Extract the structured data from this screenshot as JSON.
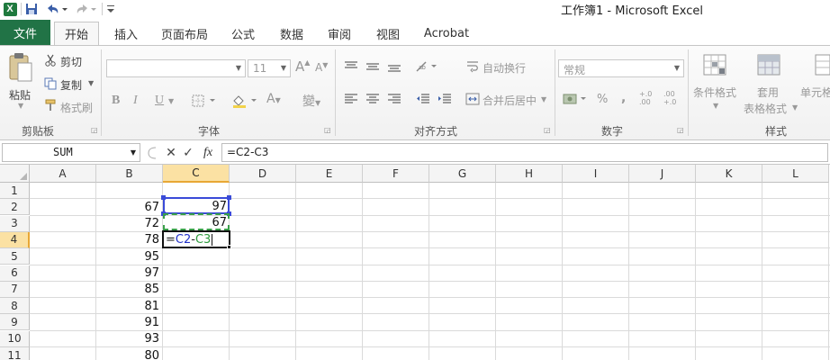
{
  "window": {
    "title": "工作簿1  -  Microsoft Excel"
  },
  "quick_access": {
    "app_icon_label": "X",
    "undo_icon": "undo-icon",
    "redo_icon": "redo-icon",
    "save_icon": "save-icon"
  },
  "tabs": [
    "文件",
    "开始",
    "插入",
    "页面布局",
    "公式",
    "数据",
    "审阅",
    "视图",
    "Acrobat"
  ],
  "ribbon": {
    "clipboard": {
      "paste": "粘贴",
      "cut": "剪切",
      "copy": "复制",
      "format_painter": "格式刷",
      "label": "剪贴板"
    },
    "font": {
      "font_size": "11",
      "bold": "B",
      "italic": "I",
      "underline": "U",
      "grow": "A",
      "shrink": "A",
      "font_color": "A",
      "phonetic": "變",
      "label": "字体"
    },
    "alignment": {
      "wrap_text": "自动换行",
      "merge_center": "合并后居中",
      "label": "对齐方式"
    },
    "number": {
      "format": "常规",
      "percent": "%",
      "comma": ",",
      "inc_decimal": "+.0 .00",
      "dec_decimal": ".00 +.0",
      "label": "数字"
    },
    "styles": {
      "conditional": "条件格式",
      "table_format_1": "套用",
      "table_format_2": "表格格式",
      "cell_styles": "单元格",
      "label": "样式"
    }
  },
  "formula_bar": {
    "name_box": "SUM",
    "cancel": "✕",
    "enter": "✓",
    "fx": "fx",
    "formula": "=C2-C3"
  },
  "sheet": {
    "columns": [
      "A",
      "B",
      "C",
      "D",
      "E",
      "F",
      "G",
      "H",
      "I",
      "J",
      "K",
      "L"
    ],
    "rows": [
      "1",
      "2",
      "3",
      "4",
      "5",
      "6",
      "7",
      "8",
      "9",
      "10",
      "11"
    ],
    "colB": [
      "",
      "67",
      "72",
      "78",
      "95",
      "97",
      "85",
      "81",
      "91",
      "93",
      "80"
    ],
    "colC": {
      "C2": "97",
      "C3": "67"
    },
    "active_cell": {
      "prefix": "=",
      "ref1": "C2",
      "minus": "-",
      "ref2": "C3"
    }
  }
}
